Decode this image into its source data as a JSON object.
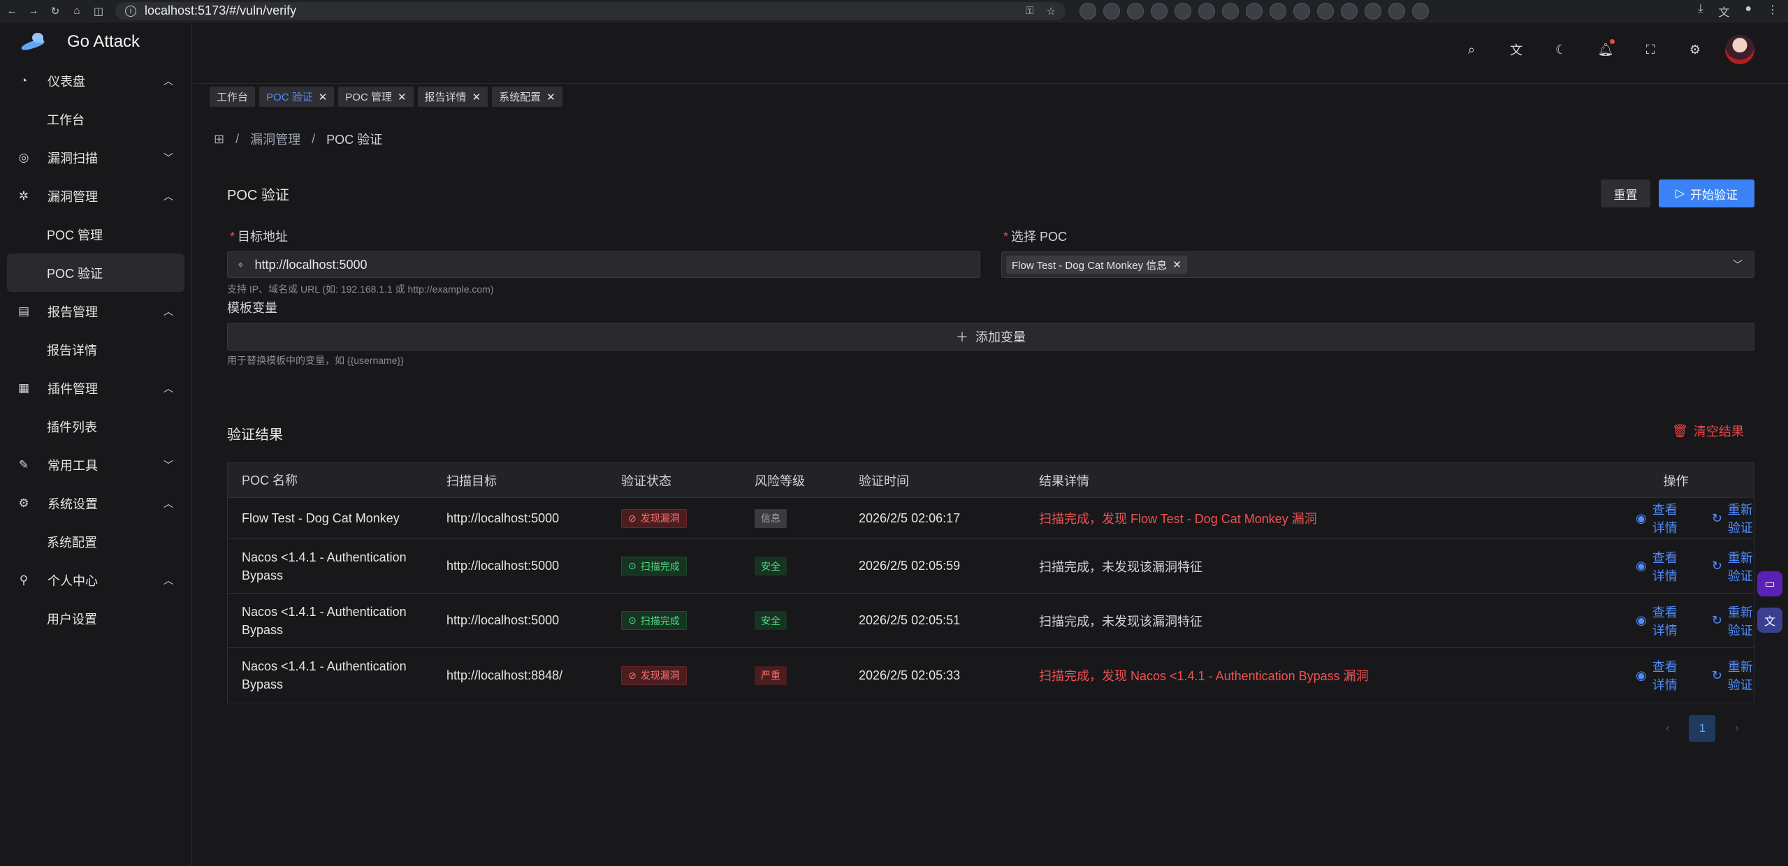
{
  "browser": {
    "url": "localhost:5173/#/vuln/verify"
  },
  "app": {
    "title": "Go Attack"
  },
  "sidebar": {
    "groups": [
      {
        "label": "仪表盘",
        "icon": "dashboard-icon",
        "expanded": true,
        "items": [
          "工作台"
        ]
      },
      {
        "label": "漏洞扫描",
        "icon": "scan-icon",
        "expanded": false,
        "items": []
      },
      {
        "label": "漏洞管理",
        "icon": "bug-icon",
        "expanded": true,
        "items": [
          "POC 管理",
          "POC 验证"
        ]
      },
      {
        "label": "报告管理",
        "icon": "report-icon",
        "expanded": true,
        "items": [
          "报告详情"
        ]
      },
      {
        "label": "插件管理",
        "icon": "plugin-icon",
        "expanded": true,
        "items": [
          "插件列表"
        ]
      },
      {
        "label": "常用工具",
        "icon": "wrench-icon",
        "expanded": false,
        "items": []
      },
      {
        "label": "系统设置",
        "icon": "settings-icon",
        "expanded": true,
        "items": [
          "系统配置"
        ]
      },
      {
        "label": "个人中心",
        "icon": "user-icon",
        "expanded": true,
        "items": [
          "用户设置"
        ]
      }
    ],
    "active_item": "POC 验证"
  },
  "tabs": [
    {
      "label": "工作台",
      "closable": false,
      "active": false
    },
    {
      "label": "POC 验证",
      "closable": true,
      "active": true
    },
    {
      "label": "POC 管理",
      "closable": true,
      "active": false
    },
    {
      "label": "报告详情",
      "closable": true,
      "active": false
    },
    {
      "label": "系统配置",
      "closable": true,
      "active": false
    }
  ],
  "breadcrumb": [
    "漏洞管理",
    "POC 验证"
  ],
  "form": {
    "title": "POC 验证",
    "reset_label": "重置",
    "start_label": "开始验证",
    "target_label": "目标地址",
    "target_value": "http://localhost:5000",
    "target_hint": "支持 IP、域名或 URL (如: 192.168.1.1 或 http://example.com)",
    "poc_label": "选择 POC",
    "poc_selected": "Flow Test - Dog Cat Monkey 信息",
    "vars_label": "模板变量",
    "add_var_label": "添加变量",
    "vars_hint": "用于替换模板中的变量，如 {{username}}"
  },
  "results": {
    "title": "验证结果",
    "clear_label": "清空结果",
    "columns": [
      "POC 名称",
      "扫描目标",
      "验证状态",
      "风险等级",
      "验证时间",
      "结果详情",
      "操作"
    ],
    "view_label": "查看详情",
    "reverify_label": "重新验证",
    "rows": [
      {
        "name": "Flow Test - Dog Cat Monkey",
        "target": "http://localhost:5000",
        "status": "发现漏洞",
        "status_type": "danger",
        "level": "信息",
        "level_type": "info",
        "time": "2026/2/5 02:06:17",
        "detail": "扫描完成，发现 Flow Test - Dog Cat Monkey 漏洞",
        "detail_type": "danger"
      },
      {
        "name": "Nacos <1.4.1 - Authentication Bypass",
        "target": "http://localhost:5000",
        "status": "扫描完成",
        "status_type": "ok",
        "level": "安全",
        "level_type": "safe",
        "time": "2026/2/5 02:05:59",
        "detail": "扫描完成，未发现该漏洞特征",
        "detail_type": "normal"
      },
      {
        "name": "Nacos <1.4.1 - Authentication Bypass",
        "target": "http://localhost:5000",
        "status": "扫描完成",
        "status_type": "ok",
        "level": "安全",
        "level_type": "safe",
        "time": "2026/2/5 02:05:51",
        "detail": "扫描完成，未发现该漏洞特征",
        "detail_type": "normal"
      },
      {
        "name": "Nacos <1.4.1 - Authentication Bypass",
        "target": "http://localhost:8848/",
        "status": "发现漏洞",
        "status_type": "danger",
        "level": "严重",
        "level_type": "crit",
        "time": "2026/2/5 02:05:33",
        "detail": "扫描完成，发现 Nacos <1.4.1 - Authentication Bypass 漏洞",
        "detail_type": "danger"
      }
    ]
  },
  "pagination": {
    "current": "1"
  },
  "colors": {
    "primary": "#3b82f6",
    "danger": "#ef4444",
    "success": "#4ade80",
    "background": "#18181b"
  }
}
